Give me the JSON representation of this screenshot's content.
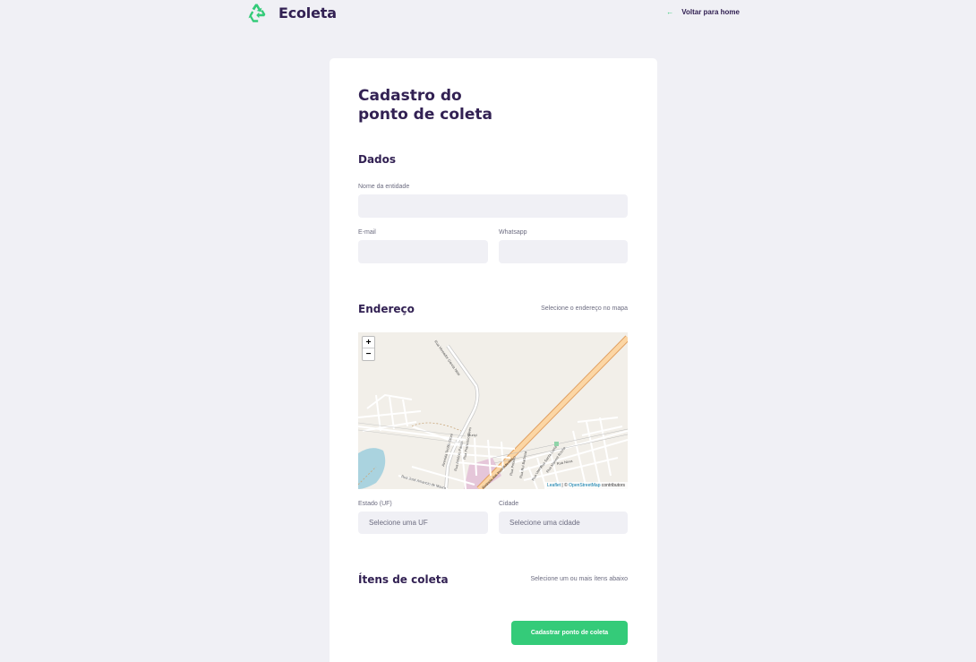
{
  "header": {
    "brand": "Ecoleta",
    "back_link": "Voltar para home"
  },
  "form": {
    "title_line1": "Cadastro do",
    "title_line2": "ponto de coleta",
    "dados": {
      "title": "Dados",
      "name_label": "Nome da entidade",
      "email_label": "E-mail",
      "whatsapp_label": "Whatsapp"
    },
    "endereco": {
      "title": "Endereço",
      "hint": "Selecione o endereço no mapa",
      "uf_label": "Estado (UF)",
      "uf_placeholder": "Selecione uma UF",
      "city_label": "Cidade",
      "city_placeholder": "Selecione uma cidade"
    },
    "itens": {
      "title": "Ítens de coleta",
      "hint": "Selecione um ou mais ítens abaixo"
    },
    "submit_label": "Cadastrar ponto de coleta"
  },
  "map": {
    "zoom_in": "+",
    "zoom_out": "−",
    "attribution_leaflet": "Leaflet",
    "attribution_sep": " | © ",
    "attribution_osm": "OpenStreetMap",
    "attribution_tail": " contributors",
    "street_labels": [
      "Rua Vereador Garcia Neto",
      "Avenida Teófilo Otoni",
      "Rua Antônio Farias",
      "Rua José Amancio de Moura",
      "Rua Francisco Alves",
      "Rua Peixoto",
      "Rua Rui Barbosa",
      "Rua Vasco",
      "Rua Santa Luzia",
      "Rua Manoel Rocha",
      "Rua Nova",
      "Muriçi",
      "Rodovia dos Inconfidentes"
    ]
  },
  "colors": {
    "brand_green": "#34cb79",
    "title_purple": "#322153",
    "bg": "#f0f0f5"
  }
}
